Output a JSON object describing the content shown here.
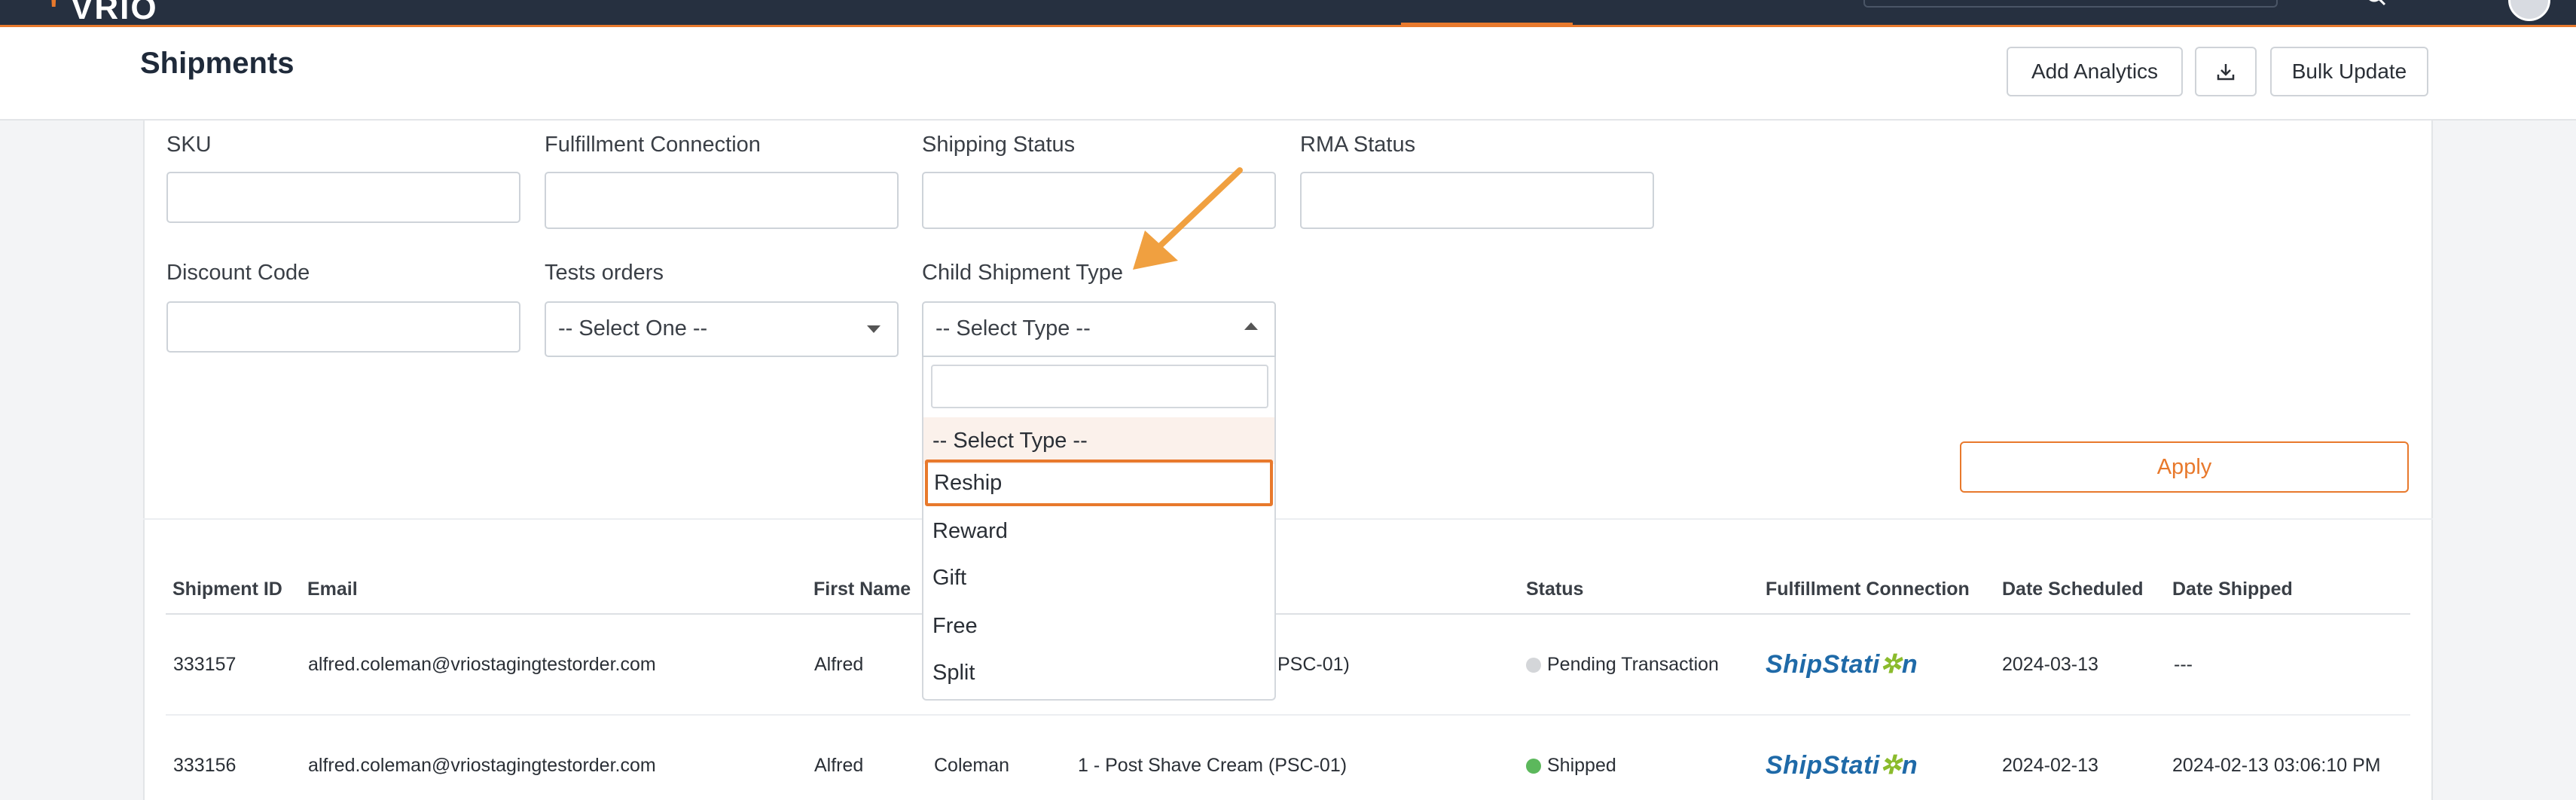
{
  "nav": {
    "logo": "VRIO",
    "logo_partial": "vrio"
  },
  "header": {
    "title": "Shipments",
    "add_analytics": "Add Analytics",
    "download_icon": "download-icon",
    "bulk_update": "Bulk Update"
  },
  "filters": {
    "sku_label": "SKU",
    "fulfillment_label": "Fulfillment Connection",
    "shipping_status_label": "Shipping Status",
    "rma_status_label": "RMA Status",
    "discount_label": "Discount Code",
    "tests_orders_label": "Tests orders",
    "tests_orders_value": "-- Select One --",
    "child_type_label": "Child Shipment Type",
    "child_type_value": "-- Select Type --",
    "apply": "Apply"
  },
  "dropdown": {
    "options": [
      "-- Select Type --",
      "Reship",
      "Reward",
      "Gift",
      "Free",
      "Split"
    ],
    "highlighted": "Reship"
  },
  "table": {
    "headers": [
      "Shipment ID",
      "Email",
      "First Name",
      "Status",
      "Fulfillment Connection",
      "Date Scheduled",
      "Date Shipped"
    ],
    "rows": [
      {
        "id": "333157",
        "email": "alfred.coleman@vriostagingtestorder.com",
        "first_name": "Alfred",
        "last_name": "",
        "product": "PSC-01)",
        "status": "Pending Transaction",
        "status_color": "#d4d6d9",
        "fulfillment": "ShipStation",
        "date_scheduled": "2024-03-13",
        "date_shipped": "---"
      },
      {
        "id": "333156",
        "email": "alfred.coleman@vriostagingtestorder.com",
        "first_name": "Alfred",
        "last_name": "Coleman",
        "product": "1 - Post Shave Cream (PSC-01)",
        "status": "Shipped",
        "status_color": "#5cb85c",
        "fulfillment": "ShipStation",
        "date_scheduled": "2024-02-13",
        "date_shipped": "2024-02-13 03:06:10 PM"
      }
    ]
  },
  "colors": {
    "accent": "#e8792c",
    "nav_bg": "#263040",
    "shipstation_blue": "#1f6aa8"
  }
}
